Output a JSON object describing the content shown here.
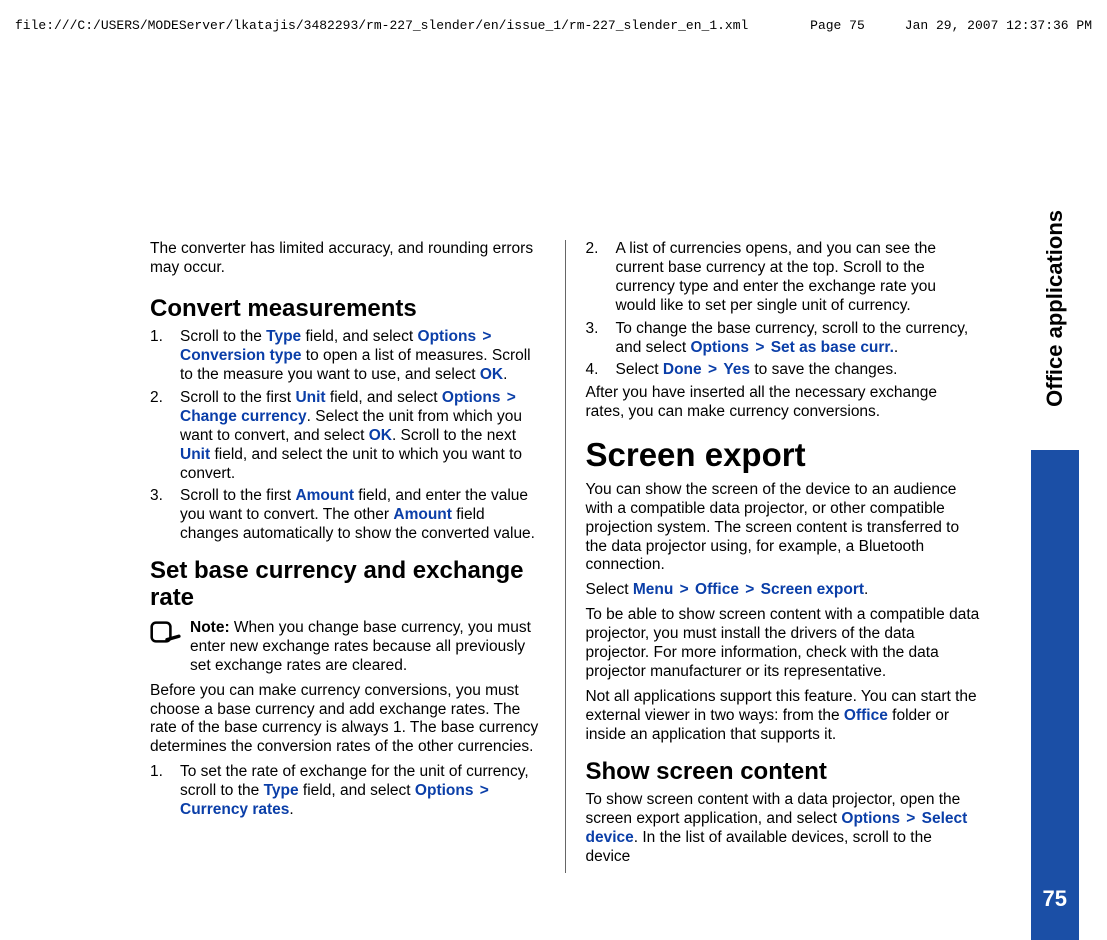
{
  "header": {
    "path": "file:///C:/USERS/MODEServer/lkatajis/3482293/rm-227_slender/en/issue_1/rm-227_slender_en_1.xml",
    "page": "Page 75",
    "date": "Jan 29, 2007 12:37:36 PM"
  },
  "sidebar": {
    "label": "Office applications",
    "pageNum": "75"
  },
  "kw": {
    "options": "Options",
    "conversionType": "Conversion type",
    "ok": "OK",
    "unit": "Unit",
    "changeCurrency": "Change currency",
    "amount": "Amount",
    "type": "Type",
    "currencyRates": "Currency rates",
    "setAsBaseCurr": "Set as base curr.",
    "done": "Done",
    "yes": "Yes",
    "menu": "Menu",
    "office": "Office",
    "screenExport": "Screen export",
    "selectDevice": "Select device"
  },
  "arrow": ">",
  "left": {
    "intro": "The converter has limited accuracy, and rounding errors may occur.",
    "h1": "Convert measurements",
    "s1a": "Scroll to the ",
    "s1b": " field, and select ",
    "s1c": " to open a list of measures. Scroll to the measure you want to use, and select ",
    "s1d": ".",
    "s2a": "Scroll to the first ",
    "s2b": " field, and select ",
    "s2c": ". Select the unit from which you want to convert, and select ",
    "s2d": ". Scroll to the next ",
    "s2e": " field, and select the unit to which you want to convert.",
    "s3a": "Scroll to the first ",
    "s3b": " field, and enter the value you want to convert. The other ",
    "s3c": " field changes automatically to show the converted value.",
    "h2": "Set base currency and exchange rate",
    "noteLabel": "Note:  ",
    "noteText": "When you change base currency, you must enter new exchange rates because all previously set exchange rates are cleared.",
    "p1": "Before you can make currency conversions, you must choose a base currency and add exchange rates. The rate of the base currency is always 1. The base currency determines the conversion rates of the other currencies.",
    "s4a": "To set the rate of exchange for the unit of currency, scroll to the ",
    "s4b": " field, and select ",
    "s4c": "."
  },
  "right": {
    "s2": "A list of currencies opens, and you can see the current base currency at the top. Scroll to the currency type and enter the exchange rate you would like to set per single unit of currency.",
    "s3a": "To change the base currency, scroll to the currency, and select ",
    "s3b": ".",
    "s4a": "Select ",
    "s4b": " to save the changes.",
    "p1": "After you have inserted all the necessary exchange rates, you can make currency conversions.",
    "h1": "Screen export",
    "p2": "You can show the screen of the device to an audience with a compatible data projector, or other compatible projection system. The screen content is transferred to the data projector using, for example, a Bluetooth connection.",
    "p3a": "Select ",
    "p3b": ".",
    "p4": "To be able to show screen content with a compatible data projector, you must install the drivers of the data projector. For more information, check with the data projector manufacturer or its representative.",
    "p5a": "Not all applications support this feature. You can start the external viewer in two ways: from the ",
    "p5b": " folder or inside an application that supports it.",
    "h2": "Show screen content",
    "p6a": "To show screen content with a data projector, open the screen export application, and select ",
    "p6b": ". In the list of available devices, scroll to the device"
  }
}
